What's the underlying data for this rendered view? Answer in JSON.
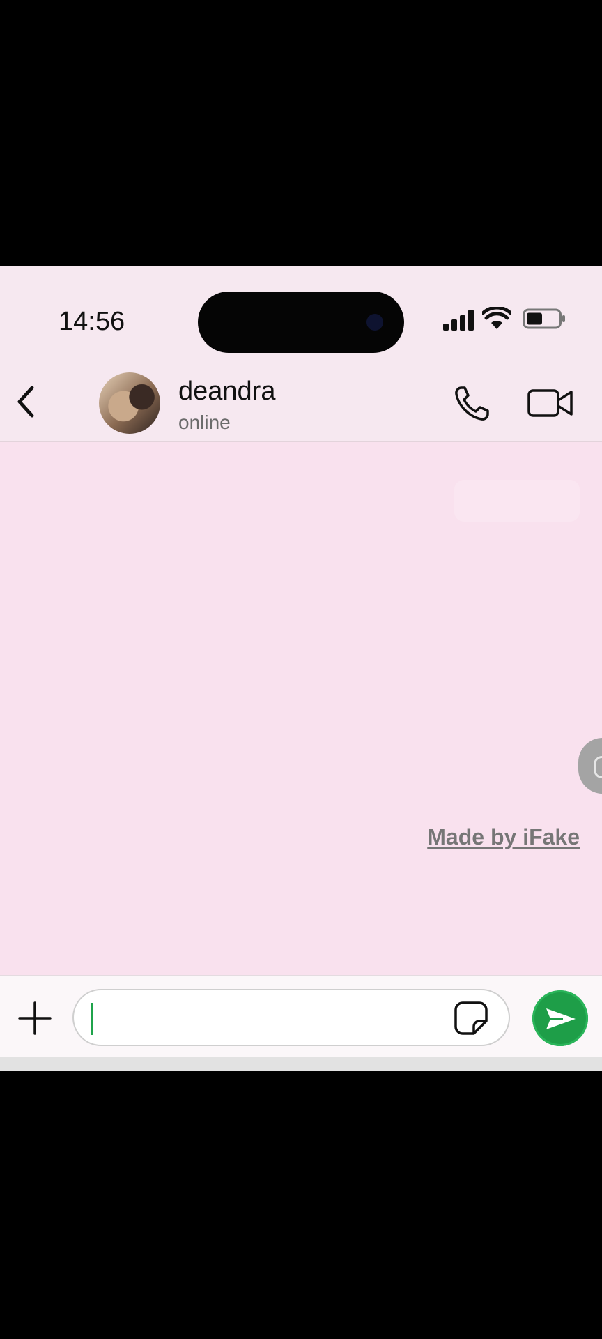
{
  "status_bar": {
    "time": "14:56"
  },
  "header": {
    "back_icon": "chevron-left-icon",
    "contact_name": "deandra",
    "contact_status": "online",
    "call_icon": "phone-icon",
    "video_icon": "video-camera-icon"
  },
  "chat": {
    "watermark": "Made by iFake"
  },
  "composer": {
    "plus_icon": "plus-icon",
    "input_value": "",
    "sticker_icon": "sticker-icon",
    "send_icon": "send-icon"
  },
  "colors": {
    "chat_background": "#f9e1ee",
    "header_background": "#f6e8f0",
    "send_button": "#1e9e48",
    "caret": "#1fa34b"
  }
}
